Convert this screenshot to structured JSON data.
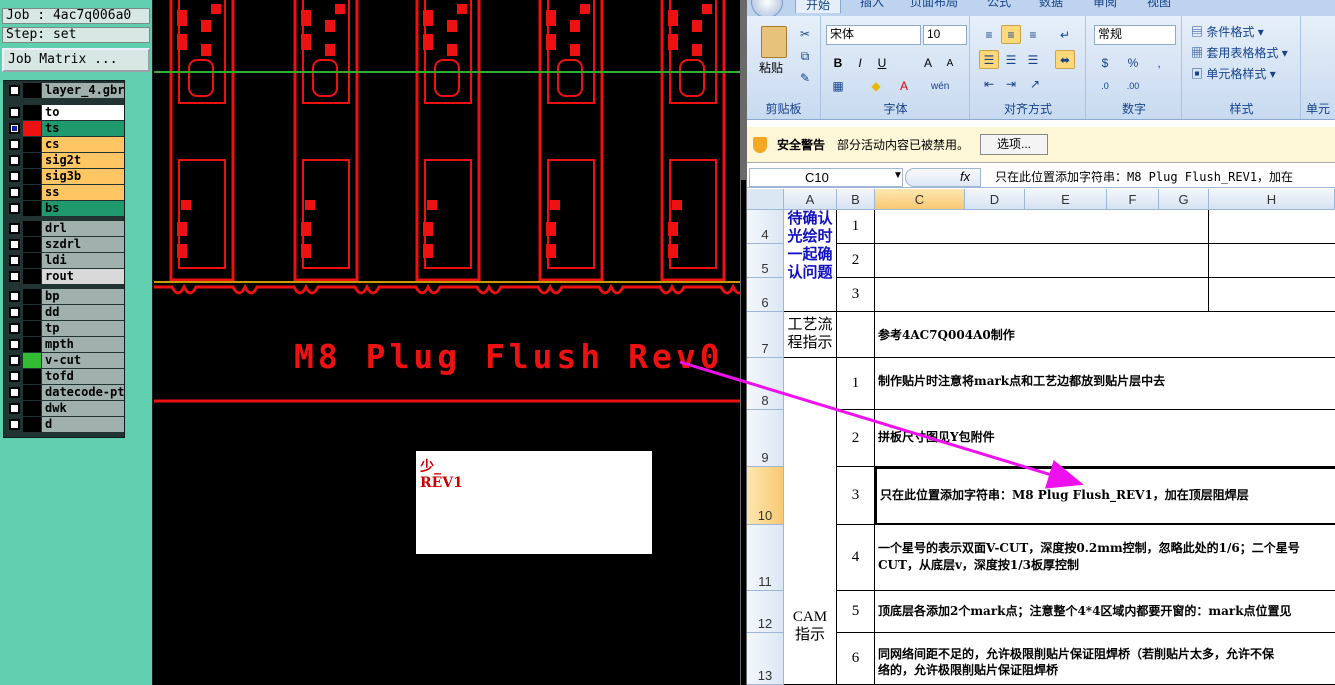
{
  "job_panel": {
    "job_label": "Job : 4ac7q006a0",
    "step_label": "Step: set",
    "job_matrix_button": "Job Matrix ...",
    "layer_file": "layer_4.gbr:",
    "layers": [
      {
        "name": "to",
        "color": "#ffffff",
        "swatch": "#000000",
        "checked": false
      },
      {
        "name": "ts",
        "color": "#1e9a6e",
        "swatch": "#ee1111",
        "checked": true
      },
      {
        "name": "cs",
        "color": "#ffc663",
        "swatch": "#000000",
        "checked": false
      },
      {
        "name": "sig2t",
        "color": "#ffc663",
        "swatch": "#000000",
        "checked": false
      },
      {
        "name": "sig3b",
        "color": "#ffc663",
        "swatch": "#000000",
        "checked": false
      },
      {
        "name": "ss",
        "color": "#ffc663",
        "swatch": "#000000",
        "checked": false
      },
      {
        "name": "bs",
        "color": "#1e9a6e",
        "swatch": "#000000",
        "checked": false
      },
      {
        "name": "drl",
        "color": "#9fb0ad",
        "swatch": "#000000",
        "checked": false
      },
      {
        "name": "szdrl",
        "color": "#9fb0ad",
        "swatch": "#000000",
        "checked": false
      },
      {
        "name": "ldi",
        "color": "#9fb0ad",
        "swatch": "#000000",
        "checked": false
      },
      {
        "name": "rout",
        "color": "#d9d9d9",
        "swatch": "#000000",
        "checked": false
      },
      {
        "name": "bp",
        "color": "#9fb0ad",
        "swatch": "#000000",
        "checked": false
      },
      {
        "name": "dd",
        "color": "#9fb0ad",
        "swatch": "#000000",
        "checked": false
      },
      {
        "name": "tp",
        "color": "#9fb0ad",
        "swatch": "#000000",
        "checked": false
      },
      {
        "name": "mpth",
        "color": "#9fb0ad",
        "swatch": "#000000",
        "checked": false
      },
      {
        "name": "v-cut",
        "color": "#9fb0ad",
        "swatch": "#33bb33",
        "checked": false
      },
      {
        "name": "tofd",
        "color": "#9fb0ad",
        "swatch": "#000000",
        "checked": false
      },
      {
        "name": "datecode-pto",
        "color": "#9fb0ad",
        "swatch": "#000000",
        "checked": false
      },
      {
        "name": "dwk",
        "color": "#9fb0ad",
        "swatch": "#000000",
        "checked": false
      },
      {
        "name": "d",
        "color": "#9fb0ad",
        "swatch": "#000000",
        "checked": false
      }
    ]
  },
  "cad_view": {
    "board_text": "M8 Plug Flush Rev0",
    "note_line1": "少_",
    "note_line2": "REV1",
    "pcb_color": "#ee1111",
    "arrow_color": "#ee11ee"
  },
  "excel": {
    "tabs": [
      "开始",
      "插入",
      "页面布局",
      "公式",
      "数据",
      "审阅",
      "视图"
    ],
    "clipboard_group": "剪贴板",
    "paste_label": "粘贴",
    "font_group": "字体",
    "font_name": "宋体",
    "font_size": "10",
    "align_group": "对齐方式",
    "number_group": "数字",
    "number_format": "常规",
    "styles_group": "样式",
    "cond_format": "条件格式",
    "table_format": "套用表格格式",
    "cell_style": "单元格样式",
    "cells_group_partial": "单元",
    "security_warning": "安全警告",
    "security_msg": "部分活动内容已被禁用。",
    "options_button": "选项...",
    "name_box": "C10",
    "fx": "fx",
    "formula": "只在此位置添加字符串：M8 Plug Flush_REV1，加在",
    "columns": [
      "A",
      "B",
      "C",
      "D",
      "E",
      "F",
      "G",
      "H"
    ],
    "rows": [
      "4",
      "5",
      "6",
      "7",
      "8",
      "9",
      "10",
      "11",
      "12",
      "13"
    ],
    "a_4_6": "待确认光绘时一起确认问题",
    "a_7": "工艺流程指示",
    "a_cam": "CAM指示",
    "b_values": [
      "1",
      "2",
      "3",
      "1",
      "2",
      "3",
      "4",
      "5",
      "6"
    ],
    "c7": "参考4AC7Q004A0制作",
    "c8": "制作贴片时注意将mark点和工艺边都放到贴片层中去",
    "c9": "拼板尺寸图见Y包附件",
    "c10": "只在此位置添加字符串：M8 Plug Flush_REV1，加在顶层阻焊层",
    "c11_l1": "一个星号的表示双面V-CUT，深度按0.2mm控制，忽略此处的1/6；二个星号",
    "c11_l2": "CUT，从底层v，深度按1/3板厚控制",
    "c12": "顶底层各添加2个mark点；注意整个4*4区域内都要开窗的：mark点位置见",
    "c13_l1": "同网络间距不足的，允许极限削贴片保证阻焊桥（若削贴片太多，允许不保",
    "c13_l2": "络的，允许极限削贴片保证阻焊桥"
  }
}
